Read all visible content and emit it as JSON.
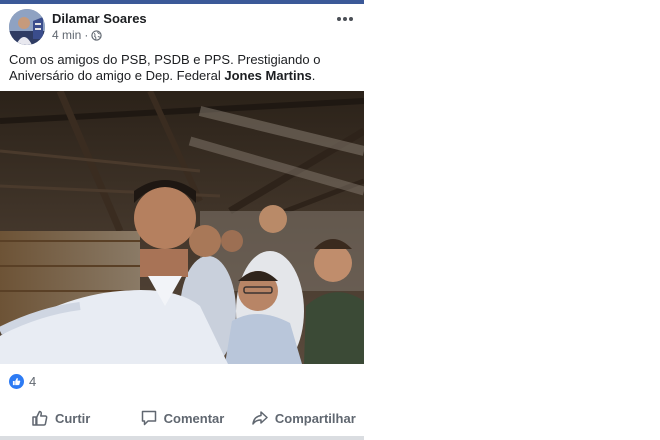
{
  "post": {
    "author": "Dilamar Soares",
    "timestamp": "4 min",
    "privacy_icon": "globe-icon",
    "menu_icon": "more-options-icon",
    "text_main": "Com os amigos do PSB, PSDB e PPS. Prestigiando o Aniversário do amigo e Dep. Federal ",
    "text_bold": "Jones Martins",
    "text_end": ".",
    "reaction_icon": "like-reaction-icon",
    "reaction_count": "4"
  },
  "actions": {
    "like_label": "Curtir",
    "comment_label": "Comentar",
    "share_label": "Compartilhar"
  },
  "colors": {
    "brand": "#3b5998",
    "like_blue": "#2d7bf4",
    "secondary_text": "#606770"
  }
}
